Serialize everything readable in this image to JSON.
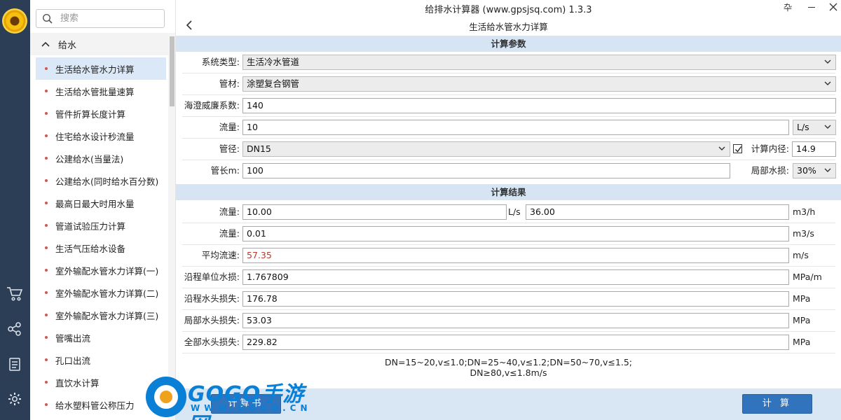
{
  "window": {
    "title": "给排水计算器 (www.gpsjsq.com) 1.3.3",
    "pin_glyph": "卆"
  },
  "page": {
    "title": "生活给水管水力详算"
  },
  "sidebar": {
    "search_placeholder": "搜索",
    "group_label": "给水",
    "items": [
      {
        "label": "生活给水管水力详算"
      },
      {
        "label": "生活给水管批量速算"
      },
      {
        "label": "管件折算长度计算"
      },
      {
        "label": "住宅给水设计秒流量"
      },
      {
        "label": "公建给水(当量法)"
      },
      {
        "label": "公建给水(同时给水百分数)"
      },
      {
        "label": "最高日最大时用水量"
      },
      {
        "label": "管道试验压力计算"
      },
      {
        "label": "生活气压给水设备"
      },
      {
        "label": "室外输配水管水力详算(一)"
      },
      {
        "label": "室外输配水管水力详算(二)"
      },
      {
        "label": "室外输配水管水力详算(三)"
      },
      {
        "label": "管嘴出流"
      },
      {
        "label": "孔口出流"
      },
      {
        "label": "直饮水计算"
      },
      {
        "label": "给水塑料管公称压力"
      }
    ]
  },
  "params": {
    "section_title": "计算参数",
    "system_type": {
      "label": "系统类型:",
      "value": "生活冷水管道"
    },
    "material": {
      "label": "管材:",
      "value": "涂塑复合钢管"
    },
    "hazen": {
      "label": "海澄威廉系数:",
      "value": "140"
    },
    "flow": {
      "label": "流量:",
      "value": "10",
      "unit": "L/s"
    },
    "diameter": {
      "label": "管径:",
      "value": "DN15",
      "calc_label": "计算内径:",
      "calc_value": "14.9"
    },
    "length": {
      "label": "管长m:",
      "value": "100",
      "local_loss_label": "局部水损:",
      "local_loss_value": "30%"
    }
  },
  "results": {
    "section_title": "计算结果",
    "flow1": {
      "label": "流量:",
      "value": "10.00",
      "unit_a": "L/s",
      "value_b": "36.00",
      "unit_b": "m3/h"
    },
    "flow2": {
      "label": "流量:",
      "value": "0.01",
      "unit": "m3/s"
    },
    "velocity": {
      "label": "平均流速:",
      "value": "57.35",
      "unit": "m/s",
      "color": "#c0392b"
    },
    "unit_loss": {
      "label": "沿程单位水损:",
      "value": "1.767809",
      "unit": "MPa/m"
    },
    "friction_loss": {
      "label": "沿程水头损失:",
      "value": "176.78",
      "unit": "MPa"
    },
    "local_loss": {
      "label": "局部水头损失:",
      "value": "53.03",
      "unit": "MPa"
    },
    "total_loss": {
      "label": "全部水头损失:",
      "value": "229.82",
      "unit": "MPa"
    },
    "note_line1": "DN=15~20,v≤1.0;DN=25~40,v≤1.2;DN=50~70,v≤1.5;",
    "note_line2": "DN≥80,v≤1.8m/s"
  },
  "buttons": {
    "report": "计算书",
    "calculate": "计 算"
  },
  "watermark": {
    "brand": "GOGO手游网",
    "url": "WWW.GOGO.CN"
  },
  "colors": {
    "rail": "#2c3e55",
    "accent": "#3173bd",
    "section": "#d6e4f3",
    "active_item": "#dbe8f7"
  }
}
